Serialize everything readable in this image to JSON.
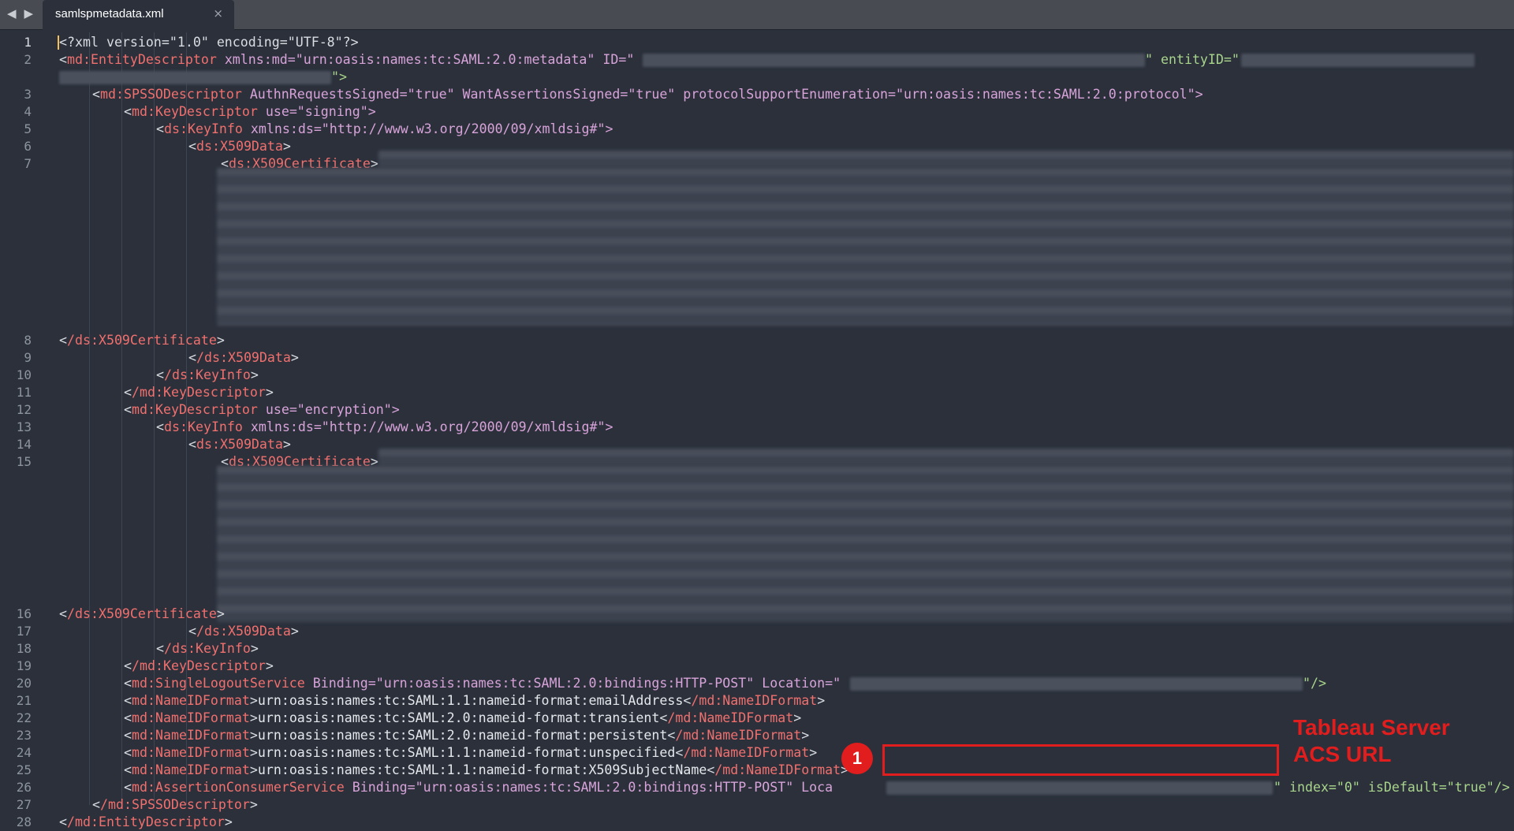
{
  "window": {
    "tab_title": "samlspmetadata.xml",
    "close_glyph": "×",
    "back_glyph": "◀",
    "forward_glyph": "▶"
  },
  "lines": {
    "n1": "1",
    "n2": "2",
    "n3": "3",
    "n4": "4",
    "n5": "5",
    "n6": "6",
    "n7": "7",
    "n8": "8",
    "n9": "9",
    "n10": "10",
    "n11": "11",
    "n12": "12",
    "n13": "13",
    "n14": "14",
    "n15": "15",
    "n16": "16",
    "n17": "17",
    "n18": "18",
    "n19": "19",
    "n20": "20",
    "n21": "21",
    "n22": "22",
    "n23": "23",
    "n24": "24",
    "n25": "25",
    "n26": "26",
    "n27": "27",
    "n28": "28"
  },
  "xml": {
    "l1_decl": "?xml version=\"1.0\" encoding=\"UTF-8\"?",
    "l2_open": "md:EntityDescriptor",
    "l2_attr": " xmlns:md=\"urn:oasis:names:tc:SAML:2.0:metadata\" ID=\"",
    "l2_entity": "\" entityID=\"",
    "l2_end": "\">",
    "l3_tag": "md:SPSSODescriptor",
    "l3_attrs": " AuthnRequestsSigned=\"true\" WantAssertionsSigned=\"true\" protocolSupportEnumeration=\"urn:oasis:names:tc:SAML:2.0:protocol\">",
    "l4_tag": "md:KeyDescriptor",
    "l4_attr": " use=\"signing\">",
    "l5_tag": "ds:KeyInfo",
    "l5_attr": " xmlns:ds=\"http://www.w3.org/2000/09/xmldsig#\">",
    "l6_tag": "ds:X509Data",
    "l7_tag": "ds:X509Certificate",
    "l8_tag": "/ds:X509Certificate",
    "l9_tag": "/ds:X509Data",
    "l10_tag": "/ds:KeyInfo",
    "l11_tag": "/md:KeyDescriptor",
    "l12_tag": "md:KeyDescriptor",
    "l12_attr": " use=\"encryption\">",
    "l13_tag": "ds:KeyInfo",
    "l13_attr": " xmlns:ds=\"http://www.w3.org/2000/09/xmldsig#\">",
    "l14_tag": "ds:X509Data",
    "l15_tag": "ds:X509Certificate",
    "l16_tag": "/ds:X509Certificate",
    "l17_tag": "/ds:X509Data",
    "l18_tag": "/ds:KeyInfo",
    "l19_tag": "/md:KeyDescriptor",
    "l20_tag": "md:SingleLogoutService",
    "l20_attr": " Binding=\"urn:oasis:names:tc:SAML:2.0:bindings:HTTP-POST\" Location=\"",
    "l20_end": "\"/>",
    "l21_text": "urn:oasis:names:tc:SAML:1.1:nameid-format:emailAddress",
    "l22_text": "urn:oasis:names:tc:SAML:2.0:nameid-format:transient",
    "l23_text": "urn:oasis:names:tc:SAML:2.0:nameid-format:persistent",
    "l24_text": "urn:oasis:names:tc:SAML:1.1:nameid-format:unspecified",
    "l25_text": "urn:oasis:names:tc:SAML:1.1:nameid-format:X509SubjectName",
    "nameid_tag": "md:NameIDFormat",
    "nameid_close": "/md:NameIDFormat",
    "l26_tag": "md:AssertionConsumerService",
    "l26_attr": " Binding=\"urn:oasis:names:tc:SAML:2.0:bindings:HTTP-POST\" Loca",
    "l26_end": "\" index=\"0\" isDefault=\"true\"/>",
    "l27_tag": "/md:SPSSODescriptor",
    "l28_tag": "/md:EntityDescriptor"
  },
  "annotation": {
    "number": "1",
    "label_line1": "Tableau Server",
    "label_line2": "ACS URL",
    "color": "#e11d1d"
  }
}
